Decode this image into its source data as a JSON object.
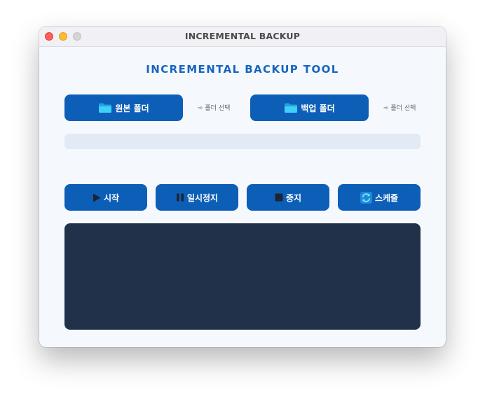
{
  "window": {
    "title": "INCREMENTAL BACKUP"
  },
  "app": {
    "heading": "INCREMENTAL BACKUP TOOL"
  },
  "folders": {
    "source": {
      "button_label": "원본 폴더",
      "icon": "folder-icon",
      "hint": "➾ 폴더 선택"
    },
    "backup": {
      "button_label": "백업 폴더",
      "icon": "folder-icon",
      "hint": "➾ 폴더 선택"
    }
  },
  "progress": {
    "value": 0
  },
  "controls": {
    "start_label": "시작",
    "pause_label": "일시정지",
    "stop_label": "중지",
    "schedule_label": "스케줄"
  },
  "log": {
    "text": ""
  },
  "colors": {
    "accent": "#1565c0",
    "button": "#0d5eb7",
    "log_background": "#213149",
    "progress_track": "#e2eaf5",
    "window_background": "#f5f8fd"
  }
}
